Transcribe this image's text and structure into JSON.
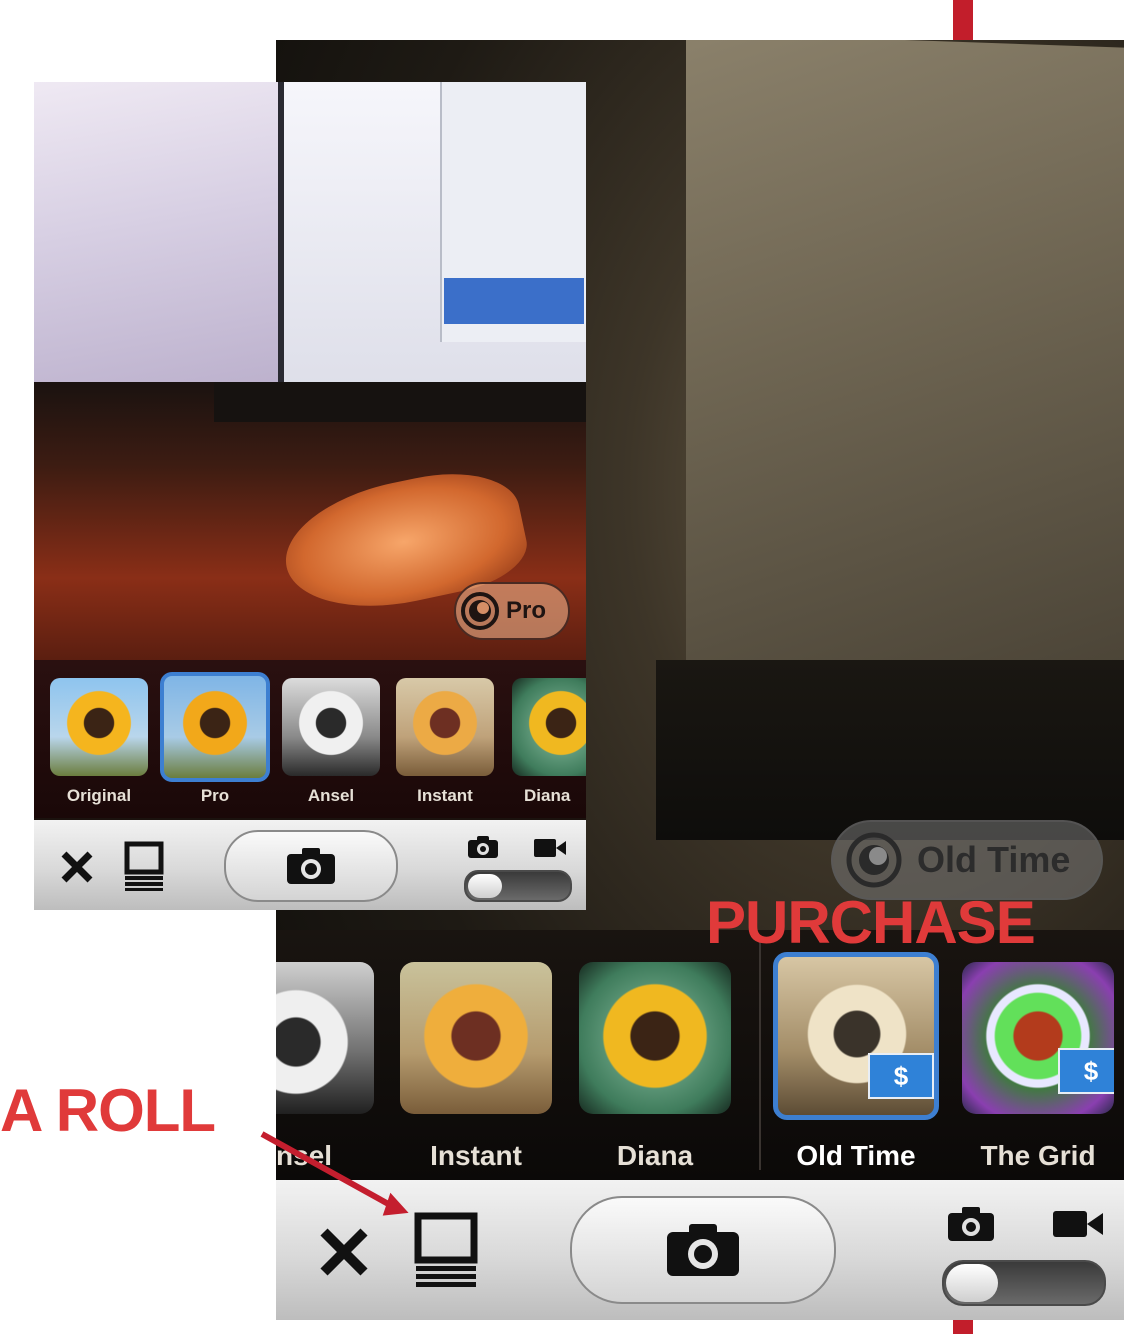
{
  "colors": {
    "accent_red": "#e03a3a",
    "selected_border": "#3d7fd1",
    "badge_blue": "#2f82d8"
  },
  "annotations": {
    "camera_roll": "A ROLL",
    "purchase": "PURCHASE"
  },
  "big_view": {
    "filter_badge": {
      "icon": "lux-circle-icon",
      "label": "Old Time"
    },
    "filters": [
      {
        "label": "nsel",
        "icon": "sunflower-bw",
        "selected": false,
        "paid": false
      },
      {
        "label": "Instant",
        "icon": "sunflower-warm",
        "selected": false,
        "paid": false
      },
      {
        "label": "Diana",
        "icon": "sunflower-vivid",
        "selected": false,
        "paid": false
      },
      {
        "label": "Old Time",
        "icon": "sunflower-sepia",
        "selected": true,
        "paid": true
      },
      {
        "label": "The Grid",
        "icon": "sunflower-neon",
        "selected": false,
        "paid": true
      }
    ],
    "paid_badge": "$"
  },
  "small_view": {
    "filter_badge": {
      "icon": "lux-circle-icon",
      "label": "Pro"
    },
    "filters": [
      {
        "label": "Original",
        "icon": "sunflower-original",
        "selected": false
      },
      {
        "label": "Pro",
        "icon": "sunflower-pro",
        "selected": true
      },
      {
        "label": "Ansel",
        "icon": "sunflower-bw",
        "selected": false
      },
      {
        "label": "Instant",
        "icon": "sunflower-warm",
        "selected": false
      },
      {
        "label": "Diana",
        "icon": "sunflower-vivid",
        "selected": false
      }
    ]
  },
  "toolbar": {
    "close_icon": "close-icon",
    "camera_roll_icon": "camera-roll-icon",
    "shutter_icon": "camera-icon",
    "photo_mode_icon": "photo-mode-icon",
    "video_mode_icon": "video-mode-icon"
  }
}
